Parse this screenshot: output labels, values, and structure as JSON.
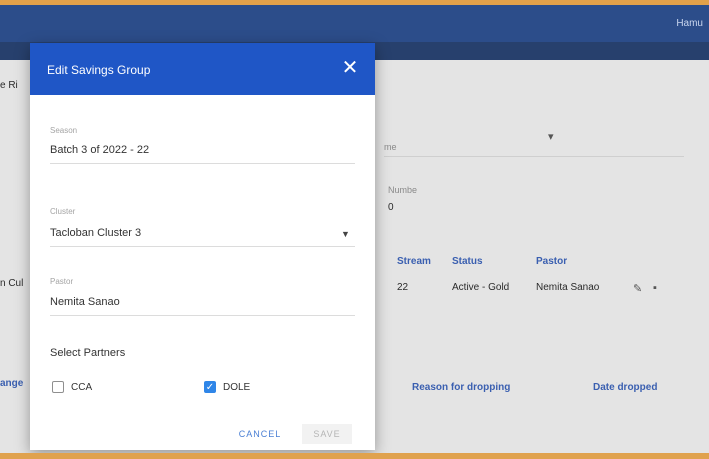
{
  "topbar": {
    "right_text": "Hamu"
  },
  "background": {
    "partial_tab": "e Ri",
    "left_partial": "n Cul",
    "right_field_1_label": "me",
    "right_field_2_label": "Numbe",
    "right_field_2_value": "0",
    "table": {
      "columns": [
        "Stream",
        "Status",
        "Pastor"
      ],
      "row": [
        "22",
        "Active - Gold",
        "Nemita Sanao"
      ]
    },
    "footer_links": [
      "Reason for dropping",
      "Date dropped"
    ],
    "footer_left": "ange"
  },
  "dialog": {
    "title": "Edit Savings Group",
    "fields": [
      {
        "label": "Season",
        "value": "Batch 3 of 2022 - 22"
      },
      {
        "label": "Cluster",
        "value": "Tacloban Cluster 3"
      },
      {
        "label": "Pastor",
        "value": "Nemita Sanao"
      }
    ],
    "partners_label": "Select Partners",
    "partners": [
      {
        "label": "CCA",
        "checked": false
      },
      {
        "label": "DOLE",
        "checked": true
      }
    ],
    "cancel_label": "CANCEL",
    "save_label": "SAVE"
  },
  "colors": {
    "header": "#1f56c6",
    "topbar": "#2c4d8a",
    "checkbox_checked": "#2f86e8",
    "link": "#3a5fb0"
  }
}
